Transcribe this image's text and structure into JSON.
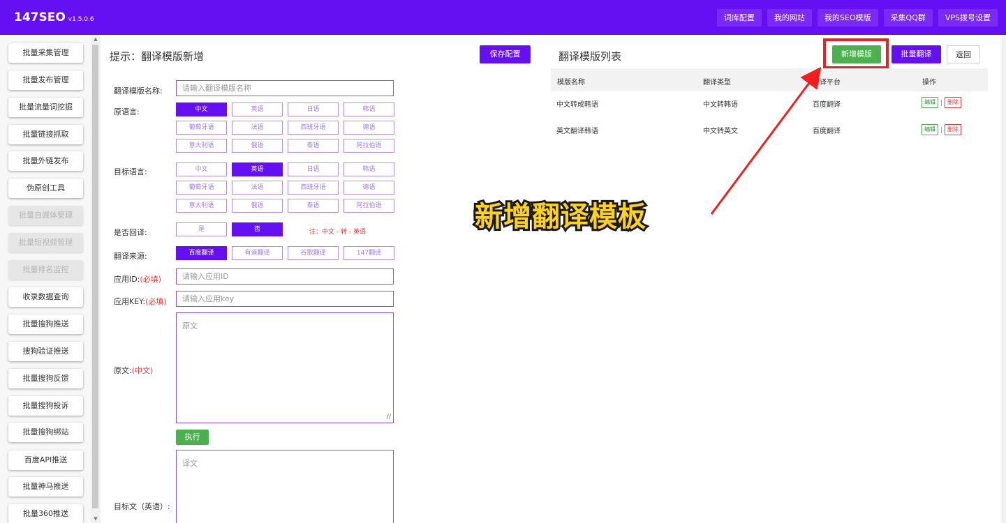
{
  "app": {
    "name": "147SEO",
    "version": "v1.5.0.6"
  },
  "topnav": [
    "词库配置",
    "我的网站",
    "我的SEO模版",
    "采集QQ群",
    "VPS拨号设置"
  ],
  "sidebar": {
    "items": [
      {
        "label": "批量采集管理",
        "disabled": false
      },
      {
        "label": "批量发布管理",
        "disabled": false
      },
      {
        "label": "批量流量词挖掘",
        "disabled": false
      },
      {
        "label": "批量链接抓取",
        "disabled": false
      },
      {
        "label": "批量外链发布",
        "disabled": false
      },
      {
        "label": "伪原创工具",
        "disabled": false
      },
      {
        "label": "批量自媒体管理",
        "disabled": true
      },
      {
        "label": "批量短视频管理",
        "disabled": true
      },
      {
        "label": "批量排名监控",
        "disabled": true
      },
      {
        "label": "收录数据查询",
        "disabled": false
      },
      {
        "label": "批量搜狗推送",
        "disabled": false
      },
      {
        "label": "搜狗验证推送",
        "disabled": false
      },
      {
        "label": "批量搜狗反馈",
        "disabled": false
      },
      {
        "label": "批量搜狗投诉",
        "disabled": false
      },
      {
        "label": "批量搜狗绑站",
        "disabled": false
      },
      {
        "label": "百度API推送",
        "disabled": false
      },
      {
        "label": "批量神马推送",
        "disabled": false
      },
      {
        "label": "批量360推送",
        "disabled": false
      }
    ]
  },
  "form": {
    "title": "提示：翻译模版新增",
    "save_label": "保存配置",
    "name_label": "翻译模版名称:",
    "name_placeholder": "请输入翻译模版名称",
    "source_label": "原语言:",
    "target_label": "目标语言:",
    "languages": [
      "中文",
      "英语",
      "日语",
      "韩语",
      "葡萄牙语",
      "法语",
      "西班牙语",
      "德语",
      "意大利语",
      "俄语",
      "泰语",
      "阿拉伯语"
    ],
    "source_selected": "中文",
    "target_selected": "英语",
    "back_translate_label": "是否回译:",
    "back_translate_options": [
      "是",
      "否"
    ],
    "back_translate_selected": "否",
    "back_translate_note": "注：中文 - 转 - 英语",
    "engine_label": "翻译来源:",
    "engines": [
      "百度翻译",
      "有道翻译",
      "谷歌翻译",
      "147翻译"
    ],
    "engine_selected": "百度翻译",
    "appid_label": "应用ID:",
    "appid_required": "(必填)",
    "appid_placeholder": "请输入应用ID",
    "appkey_label": "应用KEY:",
    "appkey_required": "(必填)",
    "appkey_placeholder": "请输入应用key",
    "original_label": "原文:",
    "original_lang": "(中文)",
    "original_placeholder": "原文",
    "run_label": "执行",
    "result_placeholder": "译文",
    "result_label": "目标文（英语）:"
  },
  "list": {
    "title": "翻译模版列表",
    "add_label": "新增模版",
    "batch_label": "批量翻译",
    "back_label": "返回",
    "columns": [
      "模版名称",
      "翻译类型",
      "翻译平台",
      "操作"
    ],
    "rows": [
      {
        "name": "中文转成韩语",
        "type": "中文转韩语",
        "platform": "百度翻译"
      },
      {
        "name": "英文翻译韩语",
        "type": "中文转英文",
        "platform": "百度翻译"
      }
    ],
    "edit_label": "编辑",
    "delete_label": "删除",
    "sep": "|"
  },
  "annotation": {
    "text": "新增翻译模板",
    "color": "#ffd21f",
    "highlight_color": "#f01e1e"
  },
  "colors": {
    "brand": "#6510f2",
    "success": "#4caf50",
    "danger": "#e53935"
  }
}
